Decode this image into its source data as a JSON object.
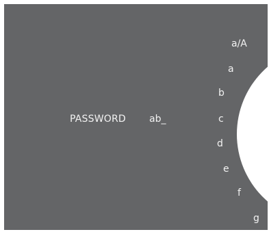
{
  "form": {
    "field_label": "PASSWORD",
    "field_value": "ab_"
  },
  "char_wheel": {
    "items": [
      "a/A",
      "a",
      "b",
      "c",
      "d",
      "e",
      "f",
      "g"
    ]
  },
  "colors": {
    "panel_background": "#646567",
    "wheel": "#ffffff",
    "text": "#f2f2f2"
  }
}
